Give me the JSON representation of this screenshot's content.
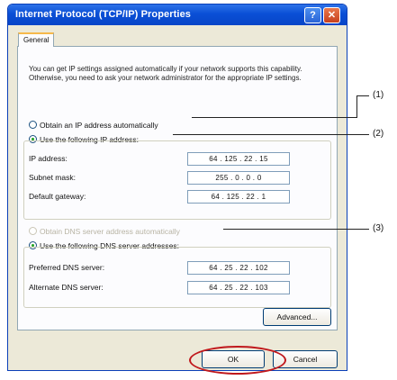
{
  "window": {
    "title": "Internet Protocol (TCP/IP) Properties",
    "help_button": "?",
    "close_button": "✕"
  },
  "tabs": [
    "General"
  ],
  "description": "You can get IP settings assigned automatically if your network supports this capability. Otherwise, you need to ask your network administrator for the appropriate IP settings.",
  "ip_mode": {
    "auto_label": "Obtain an IP address automatically",
    "manual_label": "Use the following IP address:",
    "selected": "manual"
  },
  "ip_fields": [
    {
      "label": "IP address:",
      "value": "64 . 125 . 22 . 15"
    },
    {
      "label": "Subnet mask:",
      "value": "255 . 0 . 0 . 0"
    },
    {
      "label": "Default gateway:",
      "value": "64 . 125 . 22 . 1"
    }
  ],
  "dns_mode": {
    "auto_label": "Obtain DNS server address automatically",
    "manual_label": "Use the following DNS server addresses:",
    "selected": "manual",
    "auto_disabled": true
  },
  "dns_fields": [
    {
      "label": "Preferred DNS server:",
      "value": "64 . 25 . 22 . 102"
    },
    {
      "label": "Alternate DNS server:",
      "value": "64 . 25 . 22 . 103"
    }
  ],
  "buttons": {
    "advanced": "Advanced...",
    "ok": "OK",
    "cancel": "Cancel"
  },
  "callouts": [
    "(1)",
    "(2)",
    "(3)"
  ],
  "colors": {
    "titlebar": "#0a4fd6",
    "dialog_bg": "#ece9d8",
    "highlight_ring": "#c0181c"
  }
}
